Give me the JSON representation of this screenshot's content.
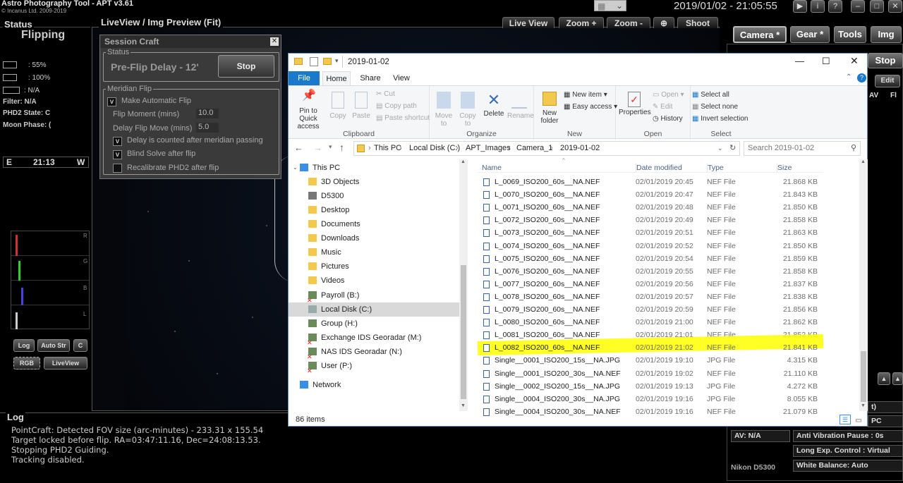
{
  "apt": {
    "title": "Astro Photography Tool  -  APT v3.61",
    "copyright": "© Incanus Ltd. 2009-2019",
    "clock": "2019/01/02 - 21:05:55",
    "status_panel": {
      "header": "Status",
      "mode": "Flipping",
      "battery1": ": 55%",
      "battery2": ": 100%",
      "value3": ": N/A",
      "filter": "Filter: N/A",
      "phd2": "PHD2 State: C",
      "moon": "Moon Phase:  (",
      "compass_left": "E",
      "compass_time": "21:13",
      "compass_right": "W"
    },
    "liveview": {
      "header": "LiveView / Img Preview (Fit)",
      "buttons": [
        "Live View",
        "Zoom +",
        "Zoom -",
        "⊕",
        "Shoot"
      ]
    },
    "histogram_labels": [
      "R",
      "G",
      "B",
      "L"
    ],
    "hist_buttons": [
      "Log",
      "Auto Str",
      "C",
      "RGB",
      "LiveView"
    ],
    "tabs": [
      "Camera *",
      "Gear *",
      "Tools",
      "Img"
    ],
    "stop_right": "Stop",
    "edit_right": "Edit",
    "av_right": [
      "AV",
      "Fl"
    ],
    "log": {
      "header": "Log",
      "lines": [
        "PointCraft: Detected FOV size (arc-minutes) - 233.31 x 155.54",
        "Target locked before flip. RA=03:47:11.16, Dec=24:08:13.53.",
        "Stopping PHD2 Guiding.",
        "Tracking disabled."
      ]
    },
    "bottom_right": {
      "av": "AV: N/A",
      "camera": "Nikon D5300",
      "pc": "PC",
      "t_suffix": "t)",
      "anti_vib": "Anti Vibration Pause : 0s",
      "long_exp": "Long Exp. Control : Virtual",
      "wb": "White Balance: Auto"
    },
    "session_craft": {
      "title": "Session Craft",
      "status_legend": "Status",
      "status_text": "Pre-Flip Delay - 12'",
      "stop": "Stop",
      "meridian_legend": "Meridian Flip",
      "make_auto": "Make Automatic Flip",
      "flip_moment_label": "Flip Moment (mins)",
      "flip_moment": "10.0",
      "delay_label": "Delay Flip Move (mins)",
      "delay": "5.0",
      "delay_counted": "Delay is counted after meridian passing",
      "blind_solve": "Blind Solve after flip",
      "recalibrate": "Recalibrate PHD2 after flip"
    }
  },
  "explorer": {
    "title": "2019-01-02",
    "tabs": [
      "File",
      "Home",
      "Share",
      "View"
    ],
    "ribbon": {
      "pin": "Pin to Quick access",
      "copy": "Copy",
      "paste": "Paste",
      "cut": "Cut",
      "copy_path": "Copy path",
      "paste_shortcut": "Paste shortcut",
      "clipboard": "Clipboard",
      "move_to": "Move to",
      "copy_to": "Copy to",
      "delete": "Delete",
      "rename": "Rename",
      "organize": "Organize",
      "new_folder": "New folder",
      "new_item": "New item ▾",
      "easy_access": "Easy access ▾",
      "new": "New",
      "properties": "Properties",
      "open": "Open ▾",
      "edit": "Edit",
      "history": "History",
      "open_grp": "Open",
      "select_all": "Select all",
      "select_none": "Select none",
      "invert": "Invert selection",
      "select": "Select"
    },
    "breadcrumb": [
      "This PC",
      "Local Disk (C:)",
      "APT_Images",
      "Camera_1",
      "2019-01-02"
    ],
    "search_placeholder": "Search 2019-01-02",
    "nav": [
      {
        "label": "This PC",
        "icon": "pc-icon"
      },
      {
        "label": "3D Objects",
        "icon": "folder-icon"
      },
      {
        "label": "D5300",
        "icon": "camera-icon"
      },
      {
        "label": "Desktop",
        "icon": "folder-icon"
      },
      {
        "label": "Documents",
        "icon": "folder-icon"
      },
      {
        "label": "Downloads",
        "icon": "folder-icon"
      },
      {
        "label": "Music",
        "icon": "folder-icon"
      },
      {
        "label": "Pictures",
        "icon": "folder-icon"
      },
      {
        "label": "Videos",
        "icon": "folder-icon"
      },
      {
        "label": "Payroll (B:)",
        "icon": "network-drive-x-icon"
      },
      {
        "label": "Local Disk (C:)",
        "icon": "drive-icon"
      },
      {
        "label": "Group (H:)",
        "icon": "network-drive-icon"
      },
      {
        "label": "Exchange IDS Georadar (M:)",
        "icon": "network-drive-x-icon"
      },
      {
        "label": "NAS IDS Georadar (N:)",
        "icon": "network-drive-x-icon"
      },
      {
        "label": "User (P:)",
        "icon": "network-drive-x-icon"
      },
      {
        "label": "Network",
        "icon": "network-icon"
      }
    ],
    "columns": [
      "Name",
      "Date modified",
      "Type",
      "Size"
    ],
    "files": [
      {
        "name": "L_0069_ISO200_60s__NA.NEF",
        "date": "02/01/2019 20:45",
        "type": "NEF File",
        "size": "21.868 KB"
      },
      {
        "name": "L_0070_ISO200_60s__NA.NEF",
        "date": "02/01/2019 20:47",
        "type": "NEF File",
        "size": "21.843 KB"
      },
      {
        "name": "L_0071_ISO200_60s__NA.NEF",
        "date": "02/01/2019 20:48",
        "type": "NEF File",
        "size": "21.850 KB"
      },
      {
        "name": "L_0072_ISO200_60s__NA.NEF",
        "date": "02/01/2019 20:49",
        "type": "NEF File",
        "size": "21.858 KB"
      },
      {
        "name": "L_0073_ISO200_60s__NA.NEF",
        "date": "02/01/2019 20:51",
        "type": "NEF File",
        "size": "21.863 KB"
      },
      {
        "name": "L_0074_ISO200_60s__NA.NEF",
        "date": "02/01/2019 20:52",
        "type": "NEF File",
        "size": "21.850 KB"
      },
      {
        "name": "L_0075_ISO200_60s__NA.NEF",
        "date": "02/01/2019 20:54",
        "type": "NEF File",
        "size": "21.859 KB"
      },
      {
        "name": "L_0076_ISO200_60s__NA.NEF",
        "date": "02/01/2019 20:55",
        "type": "NEF File",
        "size": "21.858 KB"
      },
      {
        "name": "L_0077_ISO200_60s__NA.NEF",
        "date": "02/01/2019 20:56",
        "type": "NEF File",
        "size": "21.837 KB"
      },
      {
        "name": "L_0078_ISO200_60s__NA.NEF",
        "date": "02/01/2019 20:57",
        "type": "NEF File",
        "size": "21.838 KB"
      },
      {
        "name": "L_0079_ISO200_60s__NA.NEF",
        "date": "02/01/2019 20:59",
        "type": "NEF File",
        "size": "21.856 KB"
      },
      {
        "name": "L_0080_ISO200_60s__NA.NEF",
        "date": "02/01/2019 21:00",
        "type": "NEF File",
        "size": "21.862 KB"
      },
      {
        "name": "L_0081_ISO200_60s__NA.NEF",
        "date": "02/01/2019 21:01",
        "type": "NEF File",
        "size": "21.852 KB"
      },
      {
        "name": "L_0082_ISO200_60s__NA.NEF",
        "date": "02/01/2019 21:02",
        "type": "NEF File",
        "size": "21.841 KB"
      },
      {
        "name": "Single__0001_ISO200_15s__NA.JPG",
        "date": "02/01/2019 19:10",
        "type": "JPG File",
        "size": "4.315 KB"
      },
      {
        "name": "Single__0001_ISO200_30s__NA.NEF",
        "date": "02/01/2019 19:02",
        "type": "NEF File",
        "size": "21.110 KB"
      },
      {
        "name": "Single__0002_ISO200_15s__NA.JPG",
        "date": "02/01/2019 19:13",
        "type": "JPG File",
        "size": "4.272 KB"
      },
      {
        "name": "Single__0004_ISO200_30s__NA.JPG",
        "date": "02/01/2019 19:16",
        "type": "JPG File",
        "size": "8.055 KB"
      },
      {
        "name": "Single__0004_ISO200_30s__NA.NEF",
        "date": "02/01/2019 19:16",
        "type": "NEF File",
        "size": "21.079 KB"
      }
    ],
    "highlight_color": "#ffff00",
    "status": "86 items"
  }
}
